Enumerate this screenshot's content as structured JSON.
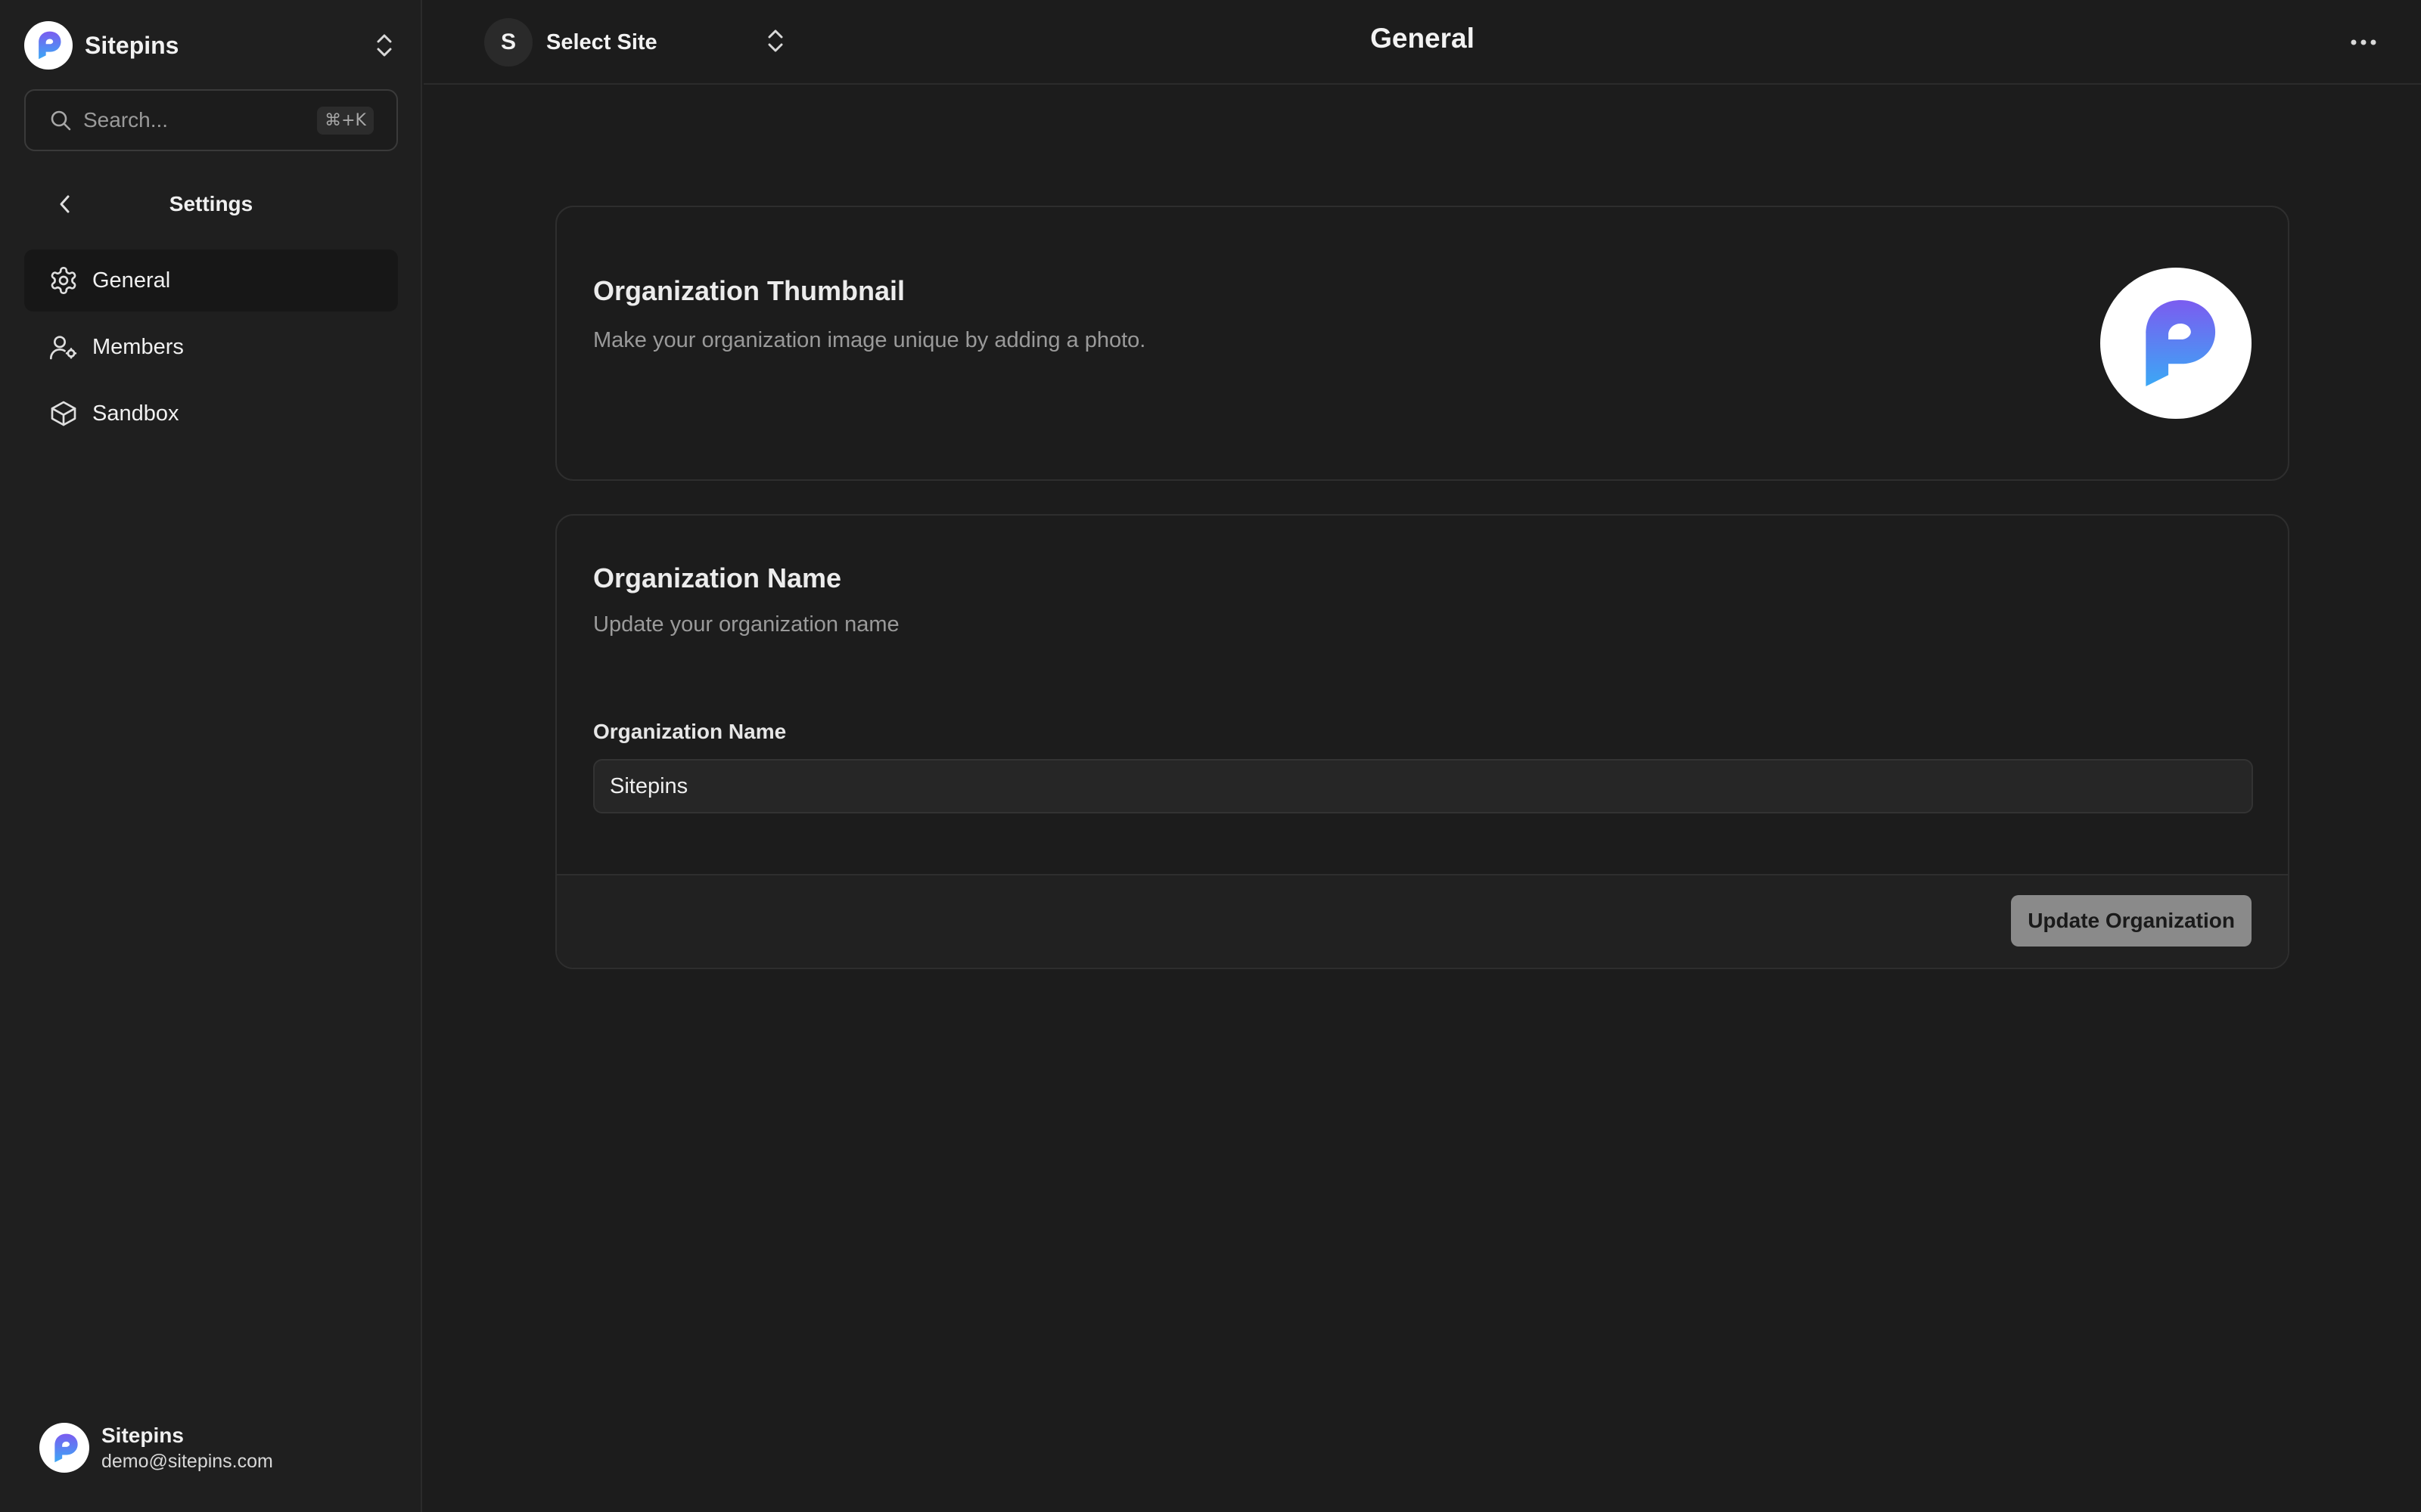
{
  "colors": {
    "accent_gradient_start": "#7b5cf0",
    "accent_gradient_end": "#3ba8f5",
    "background": "#1c1c1c"
  },
  "sidebar": {
    "org_name": "Sitepins",
    "search": {
      "placeholder": "Search...",
      "shortcut": "⌘+K"
    },
    "section_title": "Settings",
    "items": [
      {
        "label": "General",
        "icon": "gear-icon",
        "active": true
      },
      {
        "label": "Members",
        "icon": "user-settings-icon",
        "active": false
      },
      {
        "label": "Sandbox",
        "icon": "box-icon",
        "active": false
      }
    ],
    "user": {
      "name": "Sitepins",
      "email": "demo@sitepins.com"
    }
  },
  "topbar": {
    "site_avatar_letter": "S",
    "site_label": "Select Site",
    "page_title": "General"
  },
  "thumbnail_card": {
    "title": "Organization Thumbnail",
    "description": "Make your organization image unique by adding a photo."
  },
  "name_card": {
    "title": "Organization Name",
    "description": "Update your organization name",
    "field_label": "Organization Name",
    "field_value": "Sitepins",
    "button_label": "Update Organization"
  }
}
